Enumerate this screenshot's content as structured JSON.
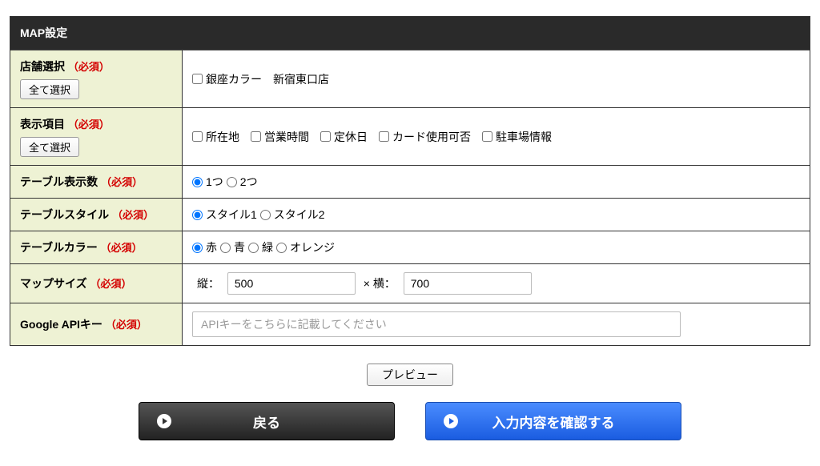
{
  "panel": {
    "title": "MAP設定"
  },
  "labels": {
    "required": "（必須）",
    "selectAll": "全て選択",
    "vertical": "縦：",
    "horizontal": "× 横：",
    "preview": "プレビュー",
    "back": "戻る",
    "confirm": "入力内容を確認する"
  },
  "rows": {
    "store": {
      "label": "店舗選択",
      "options": [
        "銀座カラー　新宿東口店"
      ]
    },
    "displayItems": {
      "label": "表示項目",
      "options": [
        "所在地",
        "営業時間",
        "定休日",
        "カード使用可否",
        "駐車場情報"
      ]
    },
    "tableCount": {
      "label": "テーブル表示数",
      "options": [
        "1つ",
        "2つ"
      ],
      "selected": "1つ"
    },
    "tableStyle": {
      "label": "テーブルスタイル",
      "options": [
        "スタイル1",
        "スタイル2"
      ],
      "selected": "スタイル1"
    },
    "tableColor": {
      "label": "テーブルカラー",
      "options": [
        "赤",
        "青",
        "緑",
        "オレンジ"
      ],
      "selected": "赤"
    },
    "mapSize": {
      "label": "マップサイズ",
      "height": "500",
      "width": "700"
    },
    "apiKey": {
      "label": "Google APIキー",
      "placeholder": "APIキーをこちらに記載してください"
    }
  }
}
